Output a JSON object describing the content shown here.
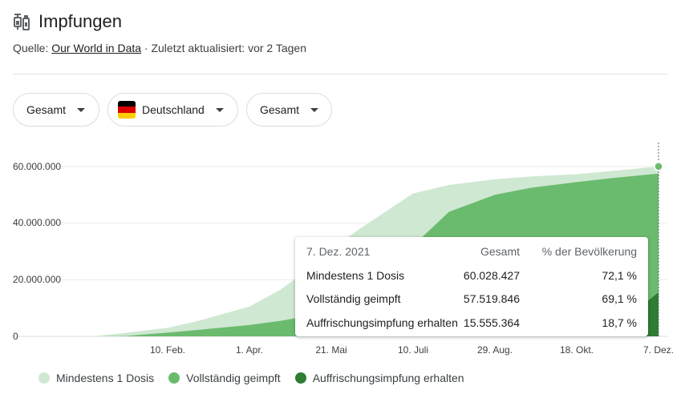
{
  "header": {
    "title": "Impfungen",
    "icon": "syringe-icon",
    "source_prefix": "Quelle:",
    "source_link": "Our World in Data",
    "source_suffix": "· Zuletzt aktualisiert: vor 2 Tagen"
  },
  "filters": {
    "metric": "Gesamt",
    "country": "Deutschland",
    "mode": "Gesamt"
  },
  "colors": {
    "light": "#cfe8d2",
    "mid": "#6abb6e",
    "dark": "#2e7d32",
    "flag_black": "#000000",
    "flag_red": "#dd0000",
    "flag_gold": "#ffce00"
  },
  "tooltip": {
    "date": "7. Dez. 2021",
    "col_total": "Gesamt",
    "col_percent": "% der Bevölkerung",
    "rows": [
      {
        "label": "Mindestens 1 Dosis",
        "total": "60.028.427",
        "percent": "72,1 %"
      },
      {
        "label": "Vollständig geimpft",
        "total": "57.519.846",
        "percent": "69,1 %"
      },
      {
        "label": "Auffrischungsimpfung erhalten",
        "total": "15.555.364",
        "percent": "18,7 %"
      }
    ]
  },
  "chart_data": {
    "type": "area",
    "y_ticks": [
      "60.000.000",
      "40.000.000",
      "20.000.000",
      "0"
    ],
    "ylim": [
      0,
      60000000
    ],
    "x_ticks": [
      "10. Feb.",
      "1. Apr.",
      "21. Mai",
      "10. Juli",
      "29. Aug.",
      "18. Okt.",
      "7. Dez."
    ],
    "x": [
      "2020-12-27",
      "2021-01-15",
      "2021-02-10",
      "2021-03-01",
      "2021-04-01",
      "2021-04-20",
      "2021-05-10",
      "2021-05-21",
      "2021-06-10",
      "2021-07-10",
      "2021-08-01",
      "2021-08-29",
      "2021-09-20",
      "2021-10-18",
      "2021-11-10",
      "2021-12-07"
    ],
    "series": [
      {
        "name": "Mindestens 1 Dosis",
        "values": [
          0,
          1200000,
          3000000,
          5500000,
          10500000,
          16500000,
          25000000,
          31000000,
          39000000,
          50500000,
          53500000,
          55500000,
          56500000,
          57300000,
          58500000,
          60028427
        ]
      },
      {
        "name": "Vollständig geimpft",
        "values": [
          0,
          100000,
          1300000,
          2300000,
          4000000,
          5500000,
          7500000,
          9500000,
          17500000,
          32000000,
          44000000,
          50000000,
          52500000,
          54500000,
          56000000,
          57519846
        ]
      },
      {
        "name": "Auffrischungsimpfung erhalten",
        "values": [
          0,
          0,
          0,
          0,
          0,
          0,
          0,
          0,
          0,
          0,
          0,
          0,
          100000,
          600000,
          3000000,
          15555364
        ]
      }
    ],
    "legend": "bottom"
  }
}
